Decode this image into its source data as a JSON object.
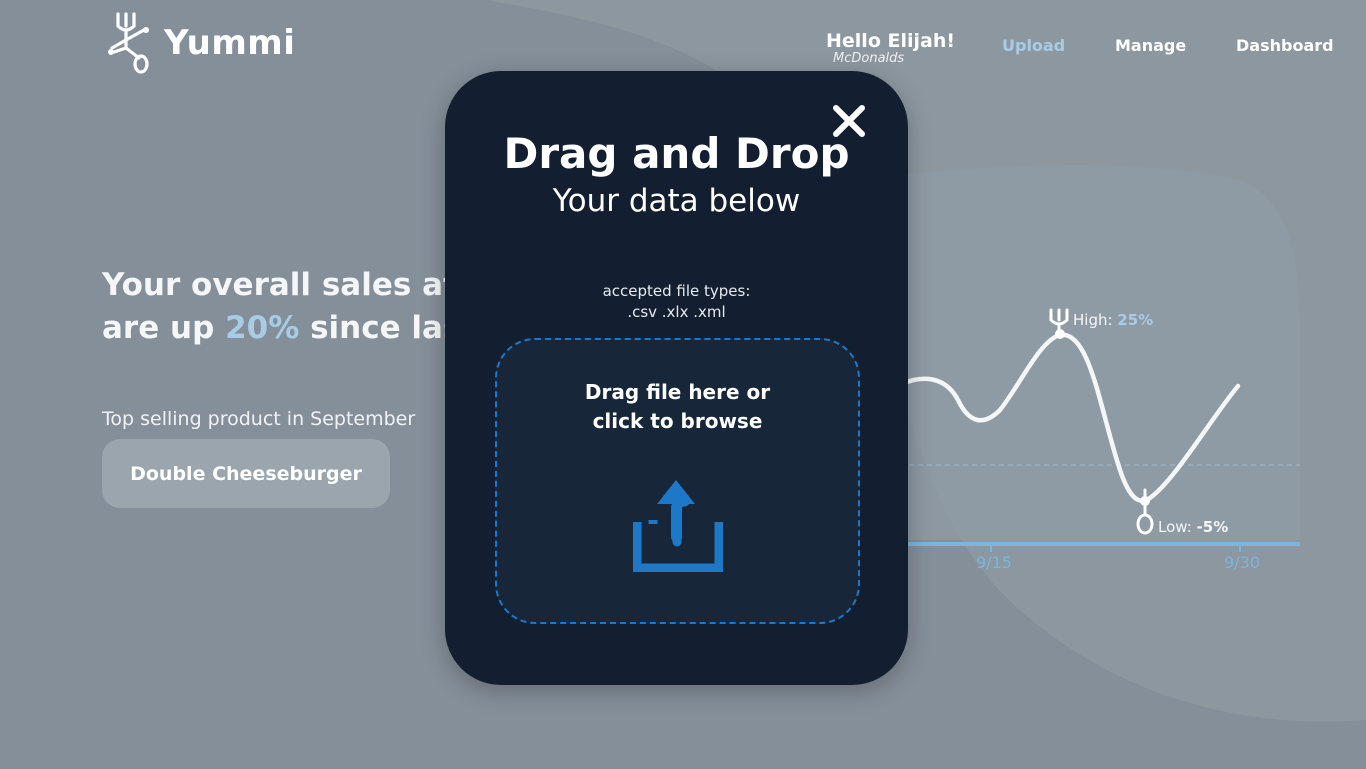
{
  "app": {
    "name": "Yummi"
  },
  "header": {
    "greeting": "Hello Elijah!",
    "company": "McDonalds",
    "nav": {
      "upload": "Upload",
      "manage": "Manage",
      "dashboard": "Dashboard"
    }
  },
  "main": {
    "headline_line1": "Your overall sales at M",
    "headline_line2_prefix": "are up ",
    "headline_pct": "20%",
    "headline_line2_suffix": " since last m",
    "top_label": "Top selling product in September",
    "top_product": "Double Cheeseburger"
  },
  "chart_data": {
    "type": "line",
    "x_ticks": [
      "9/15",
      "9/30"
    ],
    "annotations": {
      "high_label": "High: ",
      "high_value": "25%",
      "low_label": "Low: ",
      "low_value": "-5%"
    },
    "colors": {
      "line": "#ffffff",
      "axis": "#7ab6e0",
      "accent": "#a8cbe6"
    }
  },
  "modal": {
    "title": "Drag and Drop",
    "subtitle": "Your data below",
    "accepted_label": "accepted file types:",
    "accepted_types": ".csv .xlx .xml",
    "dropzone_line1": "Drag file here or",
    "dropzone_line2": "click to browse",
    "colors": {
      "background": "#131f30",
      "accent": "#1e78c8"
    }
  }
}
